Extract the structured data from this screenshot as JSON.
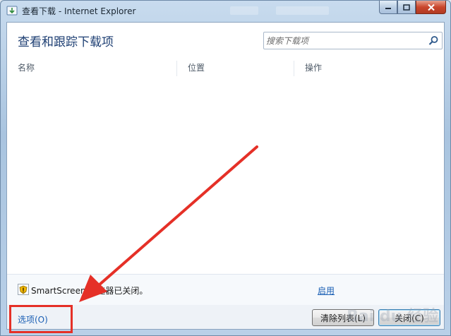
{
  "window": {
    "title": "查看下载 - Internet Explorer"
  },
  "main": {
    "heading": "查看和跟踪下载项",
    "search": {
      "placeholder": "搜索下载项",
      "value": ""
    },
    "columns": [
      "名称",
      "位置",
      "操作"
    ]
  },
  "status": {
    "text": "SmartScreen 筛选器已关闭。",
    "enable_link": "启用"
  },
  "footer": {
    "options_label": "选项(O)",
    "clear_list_label": "清除列表(L)",
    "close_label": "关闭(C)"
  },
  "watermark": "Bai du 经验",
  "colors": {
    "heading": "#1e3f73",
    "link": "#1a5fb4",
    "annotation_red": "#e53027"
  },
  "icons": {
    "title": "ie-download-icon",
    "search": "search-icon",
    "status": "shield-warning-icon"
  }
}
